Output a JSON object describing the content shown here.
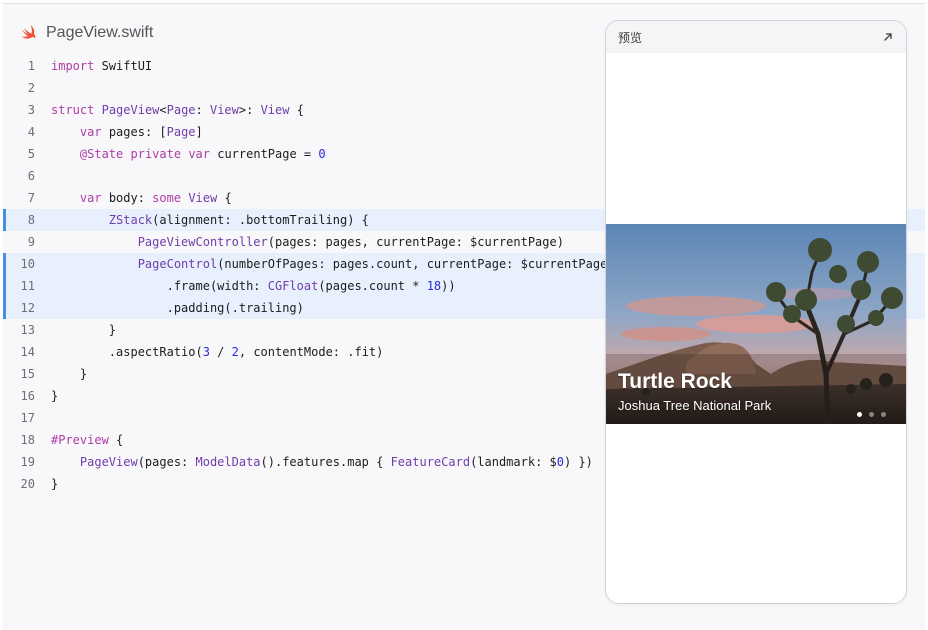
{
  "editor": {
    "file_name": "PageView.swift",
    "file_icon": "swift-icon",
    "lines": [
      {
        "n": "1",
        "code": "import SwiftUI"
      },
      {
        "n": "2",
        "code": ""
      },
      {
        "n": "3",
        "code": "struct PageView<Page: View>: View {"
      },
      {
        "n": "4",
        "code": "    var pages: [Page]"
      },
      {
        "n": "5",
        "code": "    @State private var currentPage = 0"
      },
      {
        "n": "6",
        "code": ""
      },
      {
        "n": "7",
        "code": "    var body: some View {"
      },
      {
        "n": "8",
        "code": "        ZStack(alignment: .bottomTrailing) {",
        "highlighted": true
      },
      {
        "n": "9",
        "code": "            PageViewController(pages: pages, currentPage: $currentPage)"
      },
      {
        "n": "10",
        "code": "            PageControl(numberOfPages: pages.count, currentPage: $currentPage)",
        "highlighted": true
      },
      {
        "n": "11",
        "code": "                .frame(width: CGFloat(pages.count * 18))",
        "highlighted": true
      },
      {
        "n": "12",
        "code": "                .padding(.trailing)",
        "highlighted": true
      },
      {
        "n": "13",
        "code": "        }"
      },
      {
        "n": "14",
        "code": "        .aspectRatio(3 / 2, contentMode: .fit)"
      },
      {
        "n": "15",
        "code": "    }"
      },
      {
        "n": "16",
        "code": "}"
      },
      {
        "n": "17",
        "code": ""
      },
      {
        "n": "18",
        "code": "#Preview {"
      },
      {
        "n": "19",
        "code": "    PageView(pages: ModelData().features.map { FeatureCard(landmark: $0) })"
      },
      {
        "n": "20",
        "code": "}"
      }
    ]
  },
  "preview": {
    "title": "预览",
    "expand_icon": "expand-arrow-icon",
    "card": {
      "title": "Turtle Rock",
      "subtitle": "Joshua Tree National Park",
      "page_count": 3,
      "current_page": 0
    }
  },
  "colors": {
    "keyword": "#ad3da4",
    "type": "#703daa",
    "number": "#272ad8",
    "highlight_bg": "#e8f0fe",
    "highlight_bar": "#4a90e2",
    "swift_orange": "#f05138"
  }
}
